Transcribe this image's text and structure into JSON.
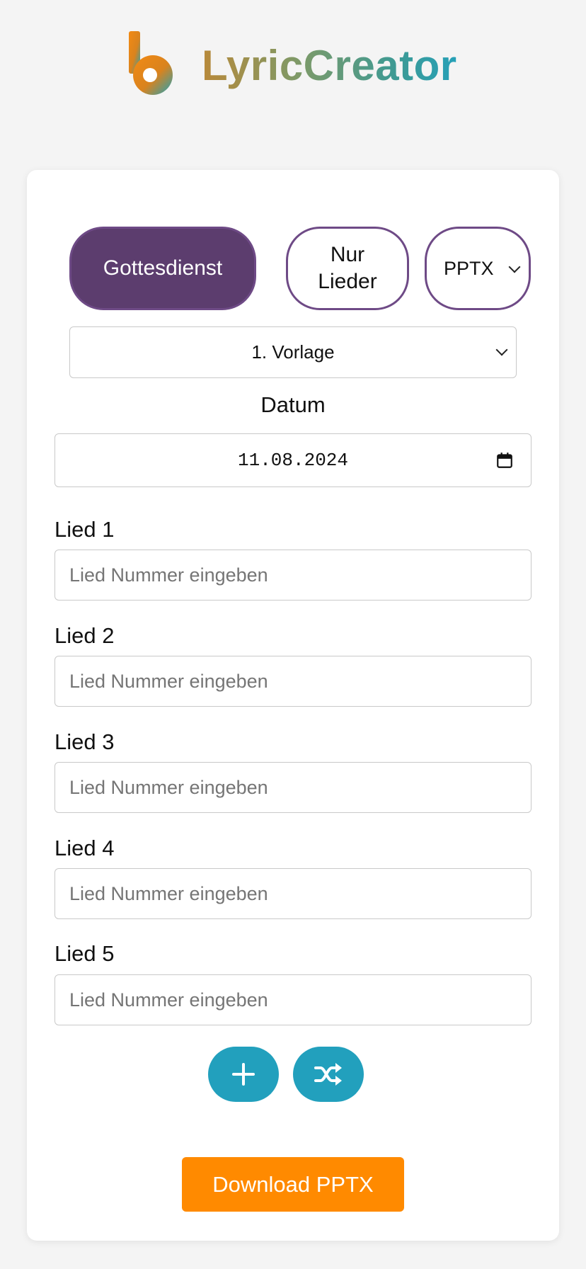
{
  "header": {
    "app_title": "LyricCreator",
    "logo_icon": "lyriccreator-logo-icon"
  },
  "modes": {
    "gottesdienst_label": "Gottesdienst",
    "nur_lieder_line1": "Nur",
    "nur_lieder_line2": "Lieder",
    "format_value": "PPTX",
    "active": "Gottesdienst"
  },
  "template_select": {
    "value": "1. Vorlage"
  },
  "date": {
    "label": "Datum",
    "value": "11.08.2024",
    "icon": "calendar-icon"
  },
  "songs": [
    {
      "label": "Lied 1",
      "placeholder": "Lied Nummer eingeben",
      "value": ""
    },
    {
      "label": "Lied 2",
      "placeholder": "Lied Nummer eingeben",
      "value": ""
    },
    {
      "label": "Lied 3",
      "placeholder": "Lied Nummer eingeben",
      "value": ""
    },
    {
      "label": "Lied 4",
      "placeholder": "Lied Nummer eingeben",
      "value": ""
    },
    {
      "label": "Lied 5",
      "placeholder": "Lied Nummer eingeben",
      "value": ""
    }
  ],
  "actions": {
    "add_icon": "plus-icon",
    "shuffle_icon": "shuffle-icon",
    "download_label": "Download PPTX"
  },
  "colors": {
    "background": "#f4f4f4",
    "primary_purple": "#5c3d6e",
    "accent_teal": "#22a0bd",
    "download_orange": "#ff8a00"
  }
}
